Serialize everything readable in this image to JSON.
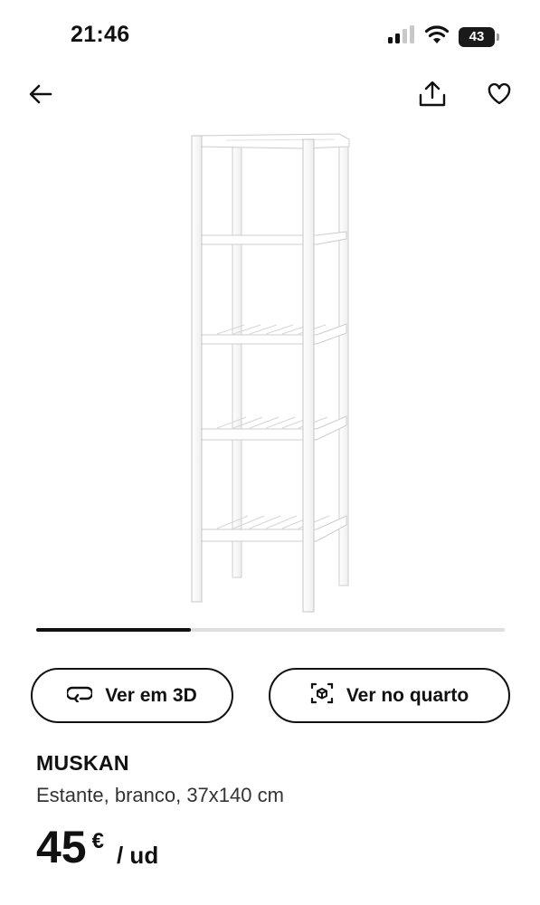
{
  "status_bar": {
    "time": "21:46",
    "battery": "43",
    "icons": [
      "cellular-signal-icon",
      "wifi-icon",
      "battery-icon"
    ]
  },
  "nav": {
    "icons": [
      "arrow-left-icon",
      "share-icon",
      "heart-icon"
    ]
  },
  "carousel": {
    "progress": 0.33
  },
  "actions": {
    "view_3d": "Ver em 3D",
    "view_in_room": "Ver no quarto"
  },
  "product": {
    "name": "MUSKAN",
    "description": "Estante, branco, 37x140 cm",
    "price": "45",
    "currency": "€",
    "unit": "/ ud"
  }
}
